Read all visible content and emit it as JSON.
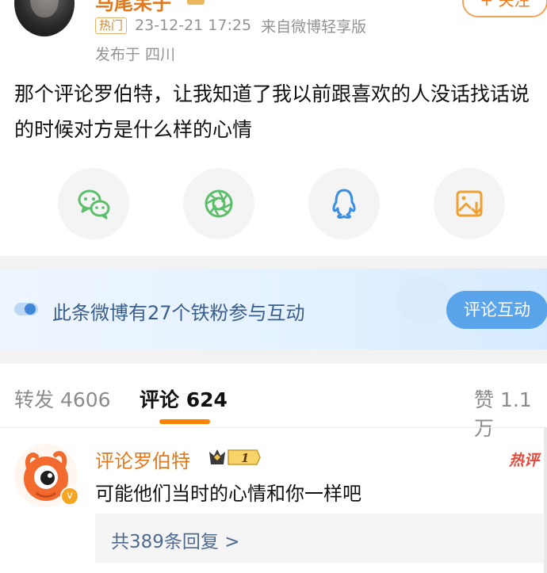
{
  "post": {
    "author_name": "马尾呆子",
    "follow_label": "+ 关注",
    "hot_tag": "热门",
    "time": "23-12-21 17:25",
    "source": "来自微博轻享版",
    "location": "发布于 四川",
    "text": "那个评论罗伯特，让我知道了我以前跟喜欢的人没话找话说的时候对方是什么样的心情"
  },
  "share": {
    "icons": [
      "wechat-icon",
      "moments-icon",
      "qq-icon",
      "save-image-icon"
    ]
  },
  "banner": {
    "text": "此条微博有27个铁粉参与互动",
    "button_label": "评论互动"
  },
  "tabs": {
    "repost_label": "转发",
    "repost_count": "4606",
    "comment_label": "评论",
    "comment_count": "624",
    "like_label": "赞",
    "like_count": "1.1万"
  },
  "comment": {
    "author_name": "评论罗伯特",
    "badge_level": "1",
    "hot_label": "热评",
    "text": "可能他们当时的心情和你一样吧",
    "replies_text": "共389条回复 >"
  },
  "colors": {
    "accent": "#ff8200",
    "name": "#e0791e",
    "link": "#4f6b8f",
    "button_blue": "#5aa4ec",
    "wechat_green": "#5bbf6a",
    "qq_blue": "#3b8fe0"
  }
}
